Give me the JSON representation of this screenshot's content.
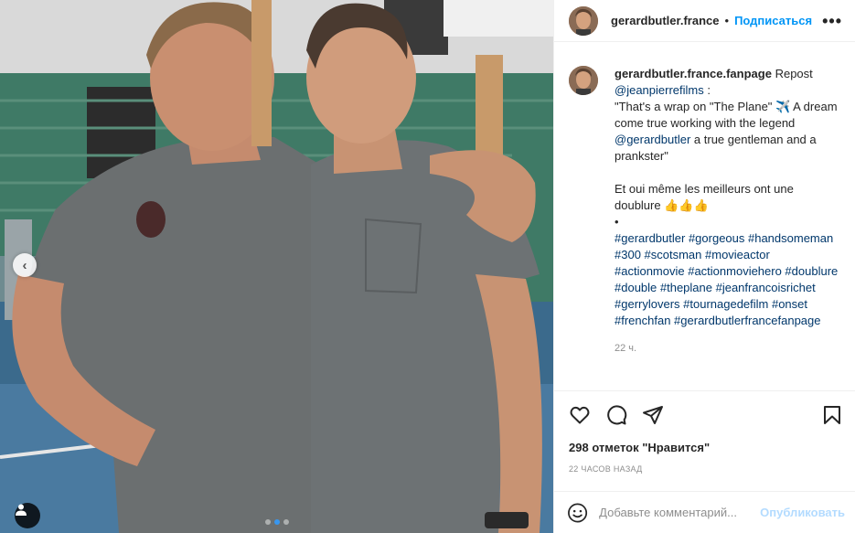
{
  "header": {
    "username": "gerardbutler.france",
    "separator": "•",
    "follow_label": "Подписаться",
    "more_glyph": "•••"
  },
  "caption": {
    "username": "gerardbutler.france.fanpage",
    "repost": "Repost",
    "mention1": "@jeanpierrefilms",
    "colon": ":",
    "line1": "\"That's a wrap on \"The Plane\" ✈️ A dream come true working with the legend",
    "mention2": "@gerardbutler",
    "line2": "a true gentleman and a prankster\"",
    "line3": "Et oui même les meilleurs ont une doublure 👍👍👍",
    "bullet": "•",
    "hashtags": "#gerardbutler #gorgeous #handsomeman #300 #scotsman #movieactor #actionmovie #actionmoviehero #doublure #double #theplane #jeanfrancoisrichet #gerrylovers #tournagedefilm #onset #frenchfan #gerardbutlerfrancefanpage",
    "time": "22 ч."
  },
  "likes": {
    "count": "298",
    "text": "отметок \"Нравится\""
  },
  "time_ago": "22 ЧАСОВ НАЗАД",
  "comment_box": {
    "placeholder": "Добавьте комментарий...",
    "post_label": "Опубликовать"
  },
  "carousel": {
    "slide_count": 3,
    "active_index": 1
  },
  "icons": {
    "like": "heart-icon",
    "comment": "comment-icon",
    "share": "paper-plane-icon",
    "save": "bookmark-icon",
    "emoji": "smiley-icon",
    "prev": "chevron-left-icon",
    "user_tag": "user-tag-icon"
  },
  "colors": {
    "link": "#00376b",
    "follow": "#0095f6",
    "post_disabled": "#b3dbff",
    "carousel_dot_active": "#3897f0"
  }
}
